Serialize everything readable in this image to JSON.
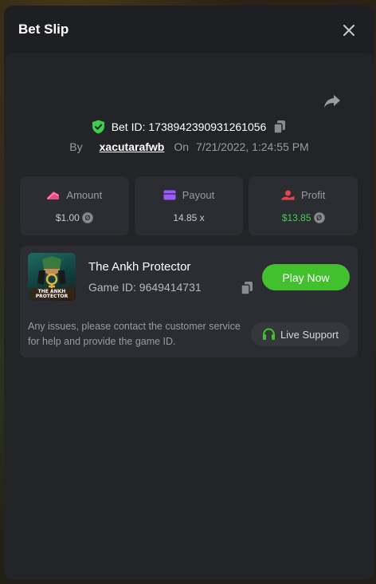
{
  "header": {
    "title": "Bet Slip"
  },
  "bet": {
    "id_label": "Bet ID: 1738942390931261056",
    "by_label": "By",
    "user": "xacutarafwb",
    "on_label": "On",
    "date": "7/21/2022, 1:24:55 PM"
  },
  "stats": {
    "amount": {
      "label": "Amount",
      "value": "$1.00"
    },
    "payout": {
      "label": "Payout",
      "value": "14.85 x"
    },
    "profit": {
      "label": "Profit",
      "value": "$13.85"
    }
  },
  "game": {
    "name": "The Ankh Protector",
    "id_label": "Game ID: 9649414731",
    "thumb_text": "THE ANKH PROTECTOR",
    "play_label": "Play Now"
  },
  "support": {
    "message": "Any issues, please contact the customer service for help and provide the game ID.",
    "button_label": "Live Support"
  },
  "colors": {
    "play_green": "#43c02e",
    "profit_green": "#43d149",
    "verified_green": "#3ecf4a",
    "amount_pink": "#e94b8a",
    "payout_purple": "#9b5cf5",
    "profit_red": "#e8454a"
  },
  "icons": {
    "close": "close-icon",
    "share": "share-icon",
    "verified": "shield-check-icon",
    "copy": "copy-icon",
    "amount": "money-icon",
    "payout": "card-icon",
    "profit": "hand-coin-icon",
    "support": "headset-icon"
  }
}
